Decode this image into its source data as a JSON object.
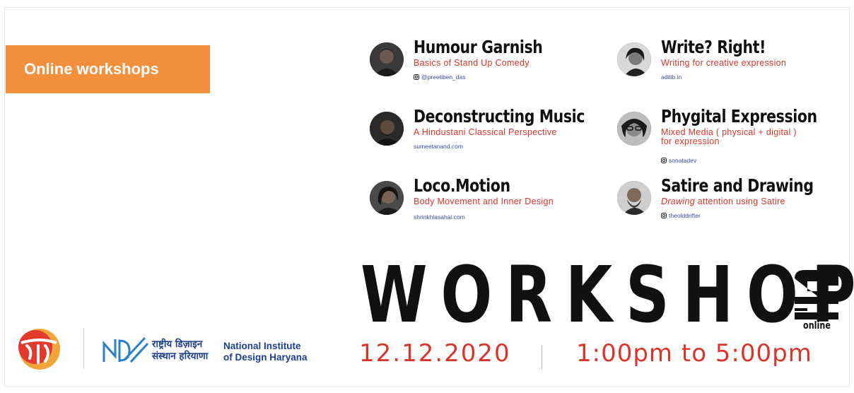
{
  "tag_label": "Online workshops",
  "workshops": [
    {
      "title": "Humour Garnish",
      "subtitle": "Basics of Stand Up Comedy",
      "handle": "@preetiben_das",
      "instagram": true
    },
    {
      "title": "Write? Right!",
      "subtitle": "Writing for creative expression",
      "handle": "aditib.in",
      "instagram": false
    },
    {
      "title": "Deconstructing Music",
      "subtitle": "A Hindustani Classical Perspective",
      "handle": "sumeetanand.com",
      "instagram": false
    },
    {
      "title": "Phygital Expression",
      "subtitle": "Mixed Media ( physical + digital )",
      "subtitle2": "for expression",
      "handle": "sonatadev",
      "instagram": true
    },
    {
      "title": "Loco.Motion",
      "subtitle": "Body Movement and Inner Design",
      "handle": "shrinkhlasahai.com",
      "instagram": false
    },
    {
      "title": "Satire and Drawing",
      "subtitle_italic": "Drawing",
      "subtitle": " attention using Satire",
      "handle": "theolddrifter",
      "instagram": true
    }
  ],
  "big_title": "WORKSHOP",
  "big_title_last": "S",
  "online_label": "online",
  "date": "12.12.2020",
  "time": "1:00pm to 5:00pm",
  "nid": {
    "hindi_line1": "राष्ट्रीय डिज़ाइन",
    "hindi_line2": "संस्थान हरियाणा",
    "english_line1": "National Institute",
    "english_line2": "of Design Haryana"
  },
  "colors": {
    "accent": "#f2903d",
    "red": "#d9352b",
    "navy": "#1e3f8f"
  }
}
